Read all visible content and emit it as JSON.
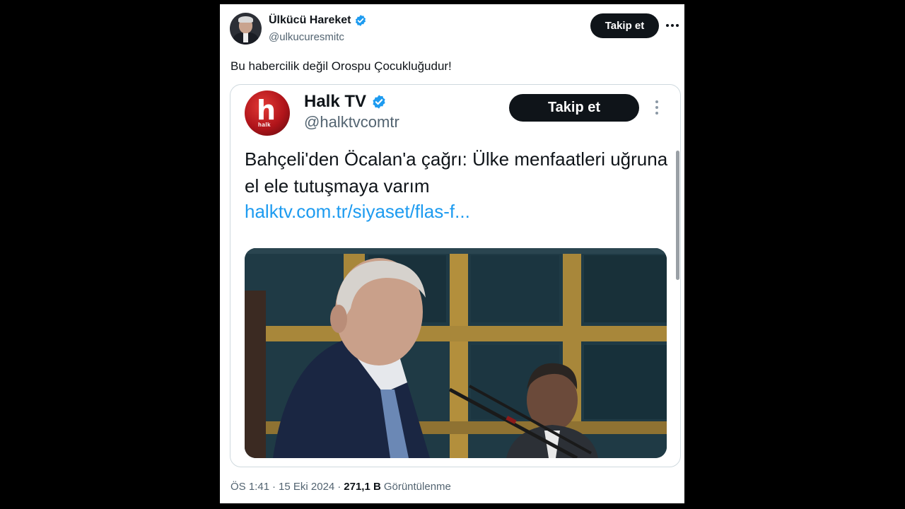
{
  "tweet": {
    "author_name": "Ülkücü Hareket",
    "author_handle": "@ulkucuresmitc",
    "follow_label": "Takip et",
    "text": "Bu habercilik değil Orospu Çocukluğudur!",
    "time": "ÖS 1:41",
    "date": "15 Eki 2024",
    "separator": "·",
    "views_count": "271,1 B",
    "views_label": "Görüntülenme"
  },
  "quoted": {
    "logo_letter": "h",
    "logo_word": "halk",
    "author_name": "Halk TV",
    "author_handle": "@halktvcomtr",
    "follow_label": "Takip et",
    "text": "Bahçeli'den Öcalan'a çağrı: Ülke menfaatleri uğruna el ele tutuşmaya varım",
    "link": "halktv.com.tr/siyaset/flas-f..."
  },
  "colors": {
    "verified": "#1d9bf0",
    "link": "#1d9bf0",
    "halk_red": "#c4161c"
  },
  "icons": [
    "verified-badge-icon",
    "more-options-icon"
  ]
}
